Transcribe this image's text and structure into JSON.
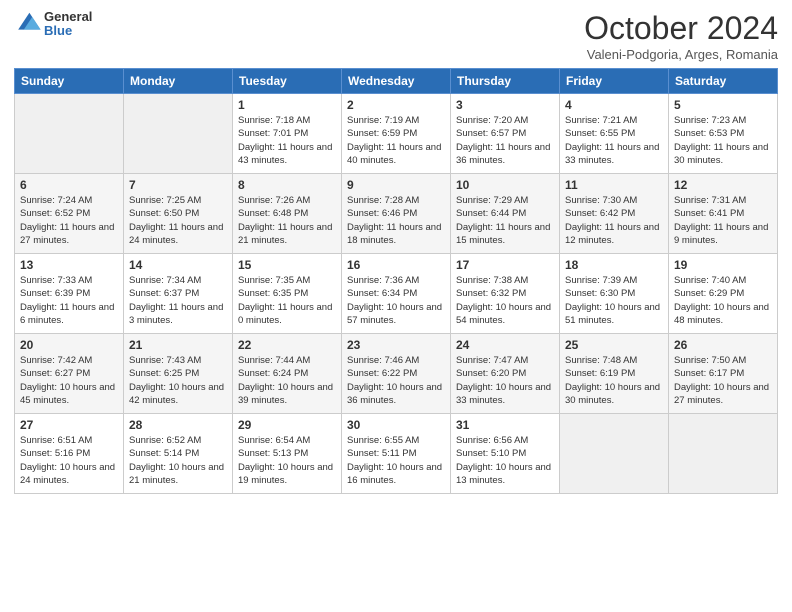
{
  "header": {
    "logo_general": "General",
    "logo_blue": "Blue",
    "month_title": "October 2024",
    "subtitle": "Valeni-Podgoria, Arges, Romania"
  },
  "weekdays": [
    "Sunday",
    "Monday",
    "Tuesday",
    "Wednesday",
    "Thursday",
    "Friday",
    "Saturday"
  ],
  "weeks": [
    [
      {
        "day": "",
        "info": ""
      },
      {
        "day": "",
        "info": ""
      },
      {
        "day": "1",
        "info": "Sunrise: 7:18 AM\nSunset: 7:01 PM\nDaylight: 11 hours and 43 minutes."
      },
      {
        "day": "2",
        "info": "Sunrise: 7:19 AM\nSunset: 6:59 PM\nDaylight: 11 hours and 40 minutes."
      },
      {
        "day": "3",
        "info": "Sunrise: 7:20 AM\nSunset: 6:57 PM\nDaylight: 11 hours and 36 minutes."
      },
      {
        "day": "4",
        "info": "Sunrise: 7:21 AM\nSunset: 6:55 PM\nDaylight: 11 hours and 33 minutes."
      },
      {
        "day": "5",
        "info": "Sunrise: 7:23 AM\nSunset: 6:53 PM\nDaylight: 11 hours and 30 minutes."
      }
    ],
    [
      {
        "day": "6",
        "info": "Sunrise: 7:24 AM\nSunset: 6:52 PM\nDaylight: 11 hours and 27 minutes."
      },
      {
        "day": "7",
        "info": "Sunrise: 7:25 AM\nSunset: 6:50 PM\nDaylight: 11 hours and 24 minutes."
      },
      {
        "day": "8",
        "info": "Sunrise: 7:26 AM\nSunset: 6:48 PM\nDaylight: 11 hours and 21 minutes."
      },
      {
        "day": "9",
        "info": "Sunrise: 7:28 AM\nSunset: 6:46 PM\nDaylight: 11 hours and 18 minutes."
      },
      {
        "day": "10",
        "info": "Sunrise: 7:29 AM\nSunset: 6:44 PM\nDaylight: 11 hours and 15 minutes."
      },
      {
        "day": "11",
        "info": "Sunrise: 7:30 AM\nSunset: 6:42 PM\nDaylight: 11 hours and 12 minutes."
      },
      {
        "day": "12",
        "info": "Sunrise: 7:31 AM\nSunset: 6:41 PM\nDaylight: 11 hours and 9 minutes."
      }
    ],
    [
      {
        "day": "13",
        "info": "Sunrise: 7:33 AM\nSunset: 6:39 PM\nDaylight: 11 hours and 6 minutes."
      },
      {
        "day": "14",
        "info": "Sunrise: 7:34 AM\nSunset: 6:37 PM\nDaylight: 11 hours and 3 minutes."
      },
      {
        "day": "15",
        "info": "Sunrise: 7:35 AM\nSunset: 6:35 PM\nDaylight: 11 hours and 0 minutes."
      },
      {
        "day": "16",
        "info": "Sunrise: 7:36 AM\nSunset: 6:34 PM\nDaylight: 10 hours and 57 minutes."
      },
      {
        "day": "17",
        "info": "Sunrise: 7:38 AM\nSunset: 6:32 PM\nDaylight: 10 hours and 54 minutes."
      },
      {
        "day": "18",
        "info": "Sunrise: 7:39 AM\nSunset: 6:30 PM\nDaylight: 10 hours and 51 minutes."
      },
      {
        "day": "19",
        "info": "Sunrise: 7:40 AM\nSunset: 6:29 PM\nDaylight: 10 hours and 48 minutes."
      }
    ],
    [
      {
        "day": "20",
        "info": "Sunrise: 7:42 AM\nSunset: 6:27 PM\nDaylight: 10 hours and 45 minutes."
      },
      {
        "day": "21",
        "info": "Sunrise: 7:43 AM\nSunset: 6:25 PM\nDaylight: 10 hours and 42 minutes."
      },
      {
        "day": "22",
        "info": "Sunrise: 7:44 AM\nSunset: 6:24 PM\nDaylight: 10 hours and 39 minutes."
      },
      {
        "day": "23",
        "info": "Sunrise: 7:46 AM\nSunset: 6:22 PM\nDaylight: 10 hours and 36 minutes."
      },
      {
        "day": "24",
        "info": "Sunrise: 7:47 AM\nSunset: 6:20 PM\nDaylight: 10 hours and 33 minutes."
      },
      {
        "day": "25",
        "info": "Sunrise: 7:48 AM\nSunset: 6:19 PM\nDaylight: 10 hours and 30 minutes."
      },
      {
        "day": "26",
        "info": "Sunrise: 7:50 AM\nSunset: 6:17 PM\nDaylight: 10 hours and 27 minutes."
      }
    ],
    [
      {
        "day": "27",
        "info": "Sunrise: 6:51 AM\nSunset: 5:16 PM\nDaylight: 10 hours and 24 minutes."
      },
      {
        "day": "28",
        "info": "Sunrise: 6:52 AM\nSunset: 5:14 PM\nDaylight: 10 hours and 21 minutes."
      },
      {
        "day": "29",
        "info": "Sunrise: 6:54 AM\nSunset: 5:13 PM\nDaylight: 10 hours and 19 minutes."
      },
      {
        "day": "30",
        "info": "Sunrise: 6:55 AM\nSunset: 5:11 PM\nDaylight: 10 hours and 16 minutes."
      },
      {
        "day": "31",
        "info": "Sunrise: 6:56 AM\nSunset: 5:10 PM\nDaylight: 10 hours and 13 minutes."
      },
      {
        "day": "",
        "info": ""
      },
      {
        "day": "",
        "info": ""
      }
    ]
  ]
}
